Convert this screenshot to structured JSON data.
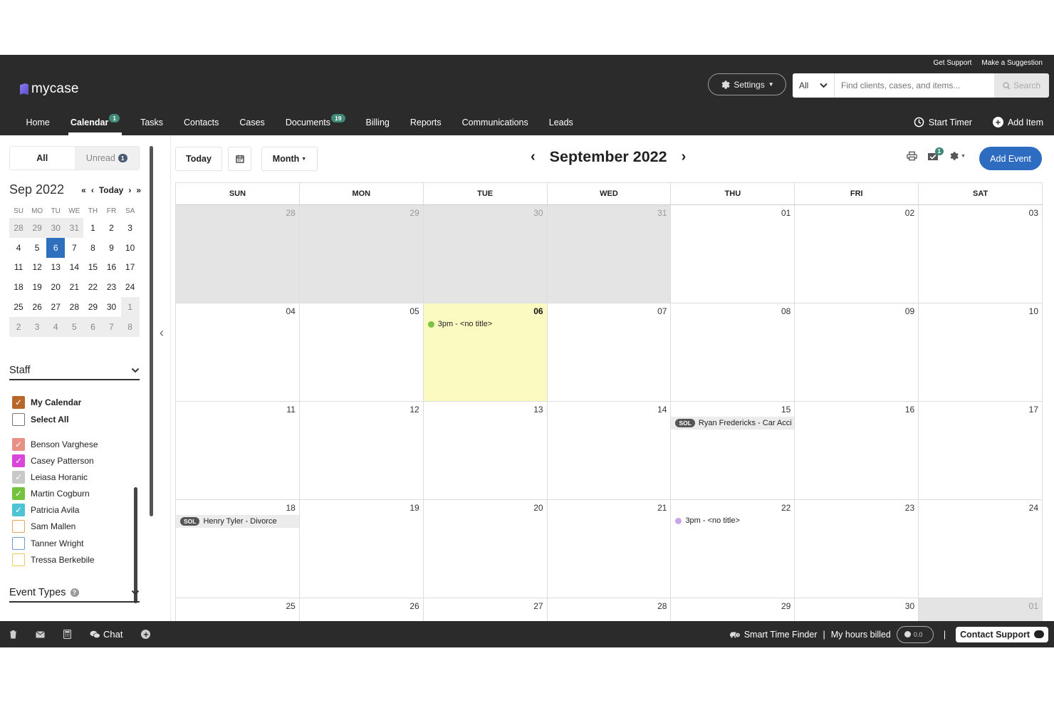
{
  "header": {
    "util_links": [
      "Get Support",
      "Make a Suggestion"
    ],
    "logo_text": "mycase",
    "settings_label": "Settings",
    "search_scope": "All",
    "search_placeholder": "Find clients, cases, and items...",
    "search_button": "Search",
    "nav": [
      {
        "label": "Home"
      },
      {
        "label": "Calendar",
        "badge": "1"
      },
      {
        "label": "Tasks"
      },
      {
        "label": "Contacts"
      },
      {
        "label": "Cases"
      },
      {
        "label": "Documents",
        "badge": "19"
      },
      {
        "label": "Billing"
      },
      {
        "label": "Reports"
      },
      {
        "label": "Communications"
      },
      {
        "label": "Leads"
      }
    ],
    "start_timer": "Start Timer",
    "add_item": "Add Item"
  },
  "sidebar": {
    "tab_all": "All",
    "tab_unread": "Unread",
    "unread_count": "1",
    "mini_title": "Sep 2022",
    "mini_today": "Today",
    "dow": [
      "SU",
      "MO",
      "TU",
      "WE",
      "TH",
      "FR",
      "SA"
    ],
    "weeks": [
      [
        "28",
        "29",
        "30",
        "31",
        "1",
        "2",
        "3"
      ],
      [
        "4",
        "5",
        "6",
        "7",
        "8",
        "9",
        "10"
      ],
      [
        "11",
        "12",
        "13",
        "14",
        "15",
        "16",
        "17"
      ],
      [
        "18",
        "19",
        "20",
        "21",
        "22",
        "23",
        "24"
      ],
      [
        "25",
        "26",
        "27",
        "28",
        "29",
        "30",
        "1"
      ],
      [
        "2",
        "3",
        "4",
        "5",
        "6",
        "7",
        "8"
      ]
    ],
    "staff_title": "Staff",
    "my_calendar": "My Calendar",
    "select_all": "Select All",
    "staff": [
      {
        "name": "Benson Varghese",
        "color": "#e88f86",
        "checked": true
      },
      {
        "name": "Casey Patterson",
        "color": "#d946d9",
        "checked": true
      },
      {
        "name": "Leiasa Horanic",
        "color": "#c8c8c8",
        "checked": true
      },
      {
        "name": "Martin Cogburn",
        "color": "#74c23e",
        "checked": true
      },
      {
        "name": "Patricia Avila",
        "color": "#4fc3d6",
        "checked": true
      },
      {
        "name": "Sam Mallen",
        "color": "#e8a45a",
        "checked": false
      },
      {
        "name": "Tanner Wright",
        "color": "#6a9ad8",
        "checked": false
      },
      {
        "name": "Tressa Berkebile",
        "color": "#e8cf5a",
        "checked": false
      }
    ],
    "event_types_title": "Event Types"
  },
  "calendar": {
    "today_label": "Today",
    "view_label": "Month",
    "month_title": "September 2022",
    "add_event": "Add Event",
    "notification_count": "1",
    "day_headers": [
      "SUN",
      "MON",
      "TUE",
      "WED",
      "THU",
      "FRI",
      "SAT"
    ],
    "weeks": [
      [
        {
          "n": "28",
          "other": true
        },
        {
          "n": "29",
          "other": true
        },
        {
          "n": "30",
          "other": true
        },
        {
          "n": "31",
          "other": true
        },
        {
          "n": "01"
        },
        {
          "n": "02"
        },
        {
          "n": "03"
        }
      ],
      [
        {
          "n": "04"
        },
        {
          "n": "05"
        },
        {
          "n": "06",
          "today": true,
          "event": {
            "text": "3pm - <no title>",
            "dot": "#7bc142"
          }
        },
        {
          "n": "07"
        },
        {
          "n": "08"
        },
        {
          "n": "09"
        },
        {
          "n": "10"
        }
      ],
      [
        {
          "n": "11"
        },
        {
          "n": "12"
        },
        {
          "n": "13"
        },
        {
          "n": "14"
        },
        {
          "n": "15",
          "event": {
            "text": "Ryan Fredericks - Car Acci",
            "sol": "SOL"
          }
        },
        {
          "n": "16"
        },
        {
          "n": "17"
        }
      ],
      [
        {
          "n": "18",
          "event": {
            "text": "Henry Tyler - Divorce",
            "sol": "SOL"
          }
        },
        {
          "n": "19"
        },
        {
          "n": "20"
        },
        {
          "n": "21"
        },
        {
          "n": "22",
          "event": {
            "text": "3pm - <no title>",
            "dot": "#c9a6e8"
          }
        },
        {
          "n": "23"
        },
        {
          "n": "24"
        }
      ],
      [
        {
          "n": "25"
        },
        {
          "n": "26"
        },
        {
          "n": "27"
        },
        {
          "n": "28"
        },
        {
          "n": "29"
        },
        {
          "n": "30"
        },
        {
          "n": "01",
          "other": true
        }
      ]
    ]
  },
  "footer": {
    "chat": "Chat",
    "smart_time_finder": "Smart Time Finder",
    "separator": "|",
    "hours_billed": "My hours billed",
    "hours_value": "0.0",
    "contact_support": "Contact Support"
  },
  "colors": {
    "header_bg": "#2b2b2b",
    "accent": "#2d6cc0",
    "badge": "#3f8a78",
    "today_bg": "#fbfbc1",
    "my_calendar": "#b8672a"
  }
}
